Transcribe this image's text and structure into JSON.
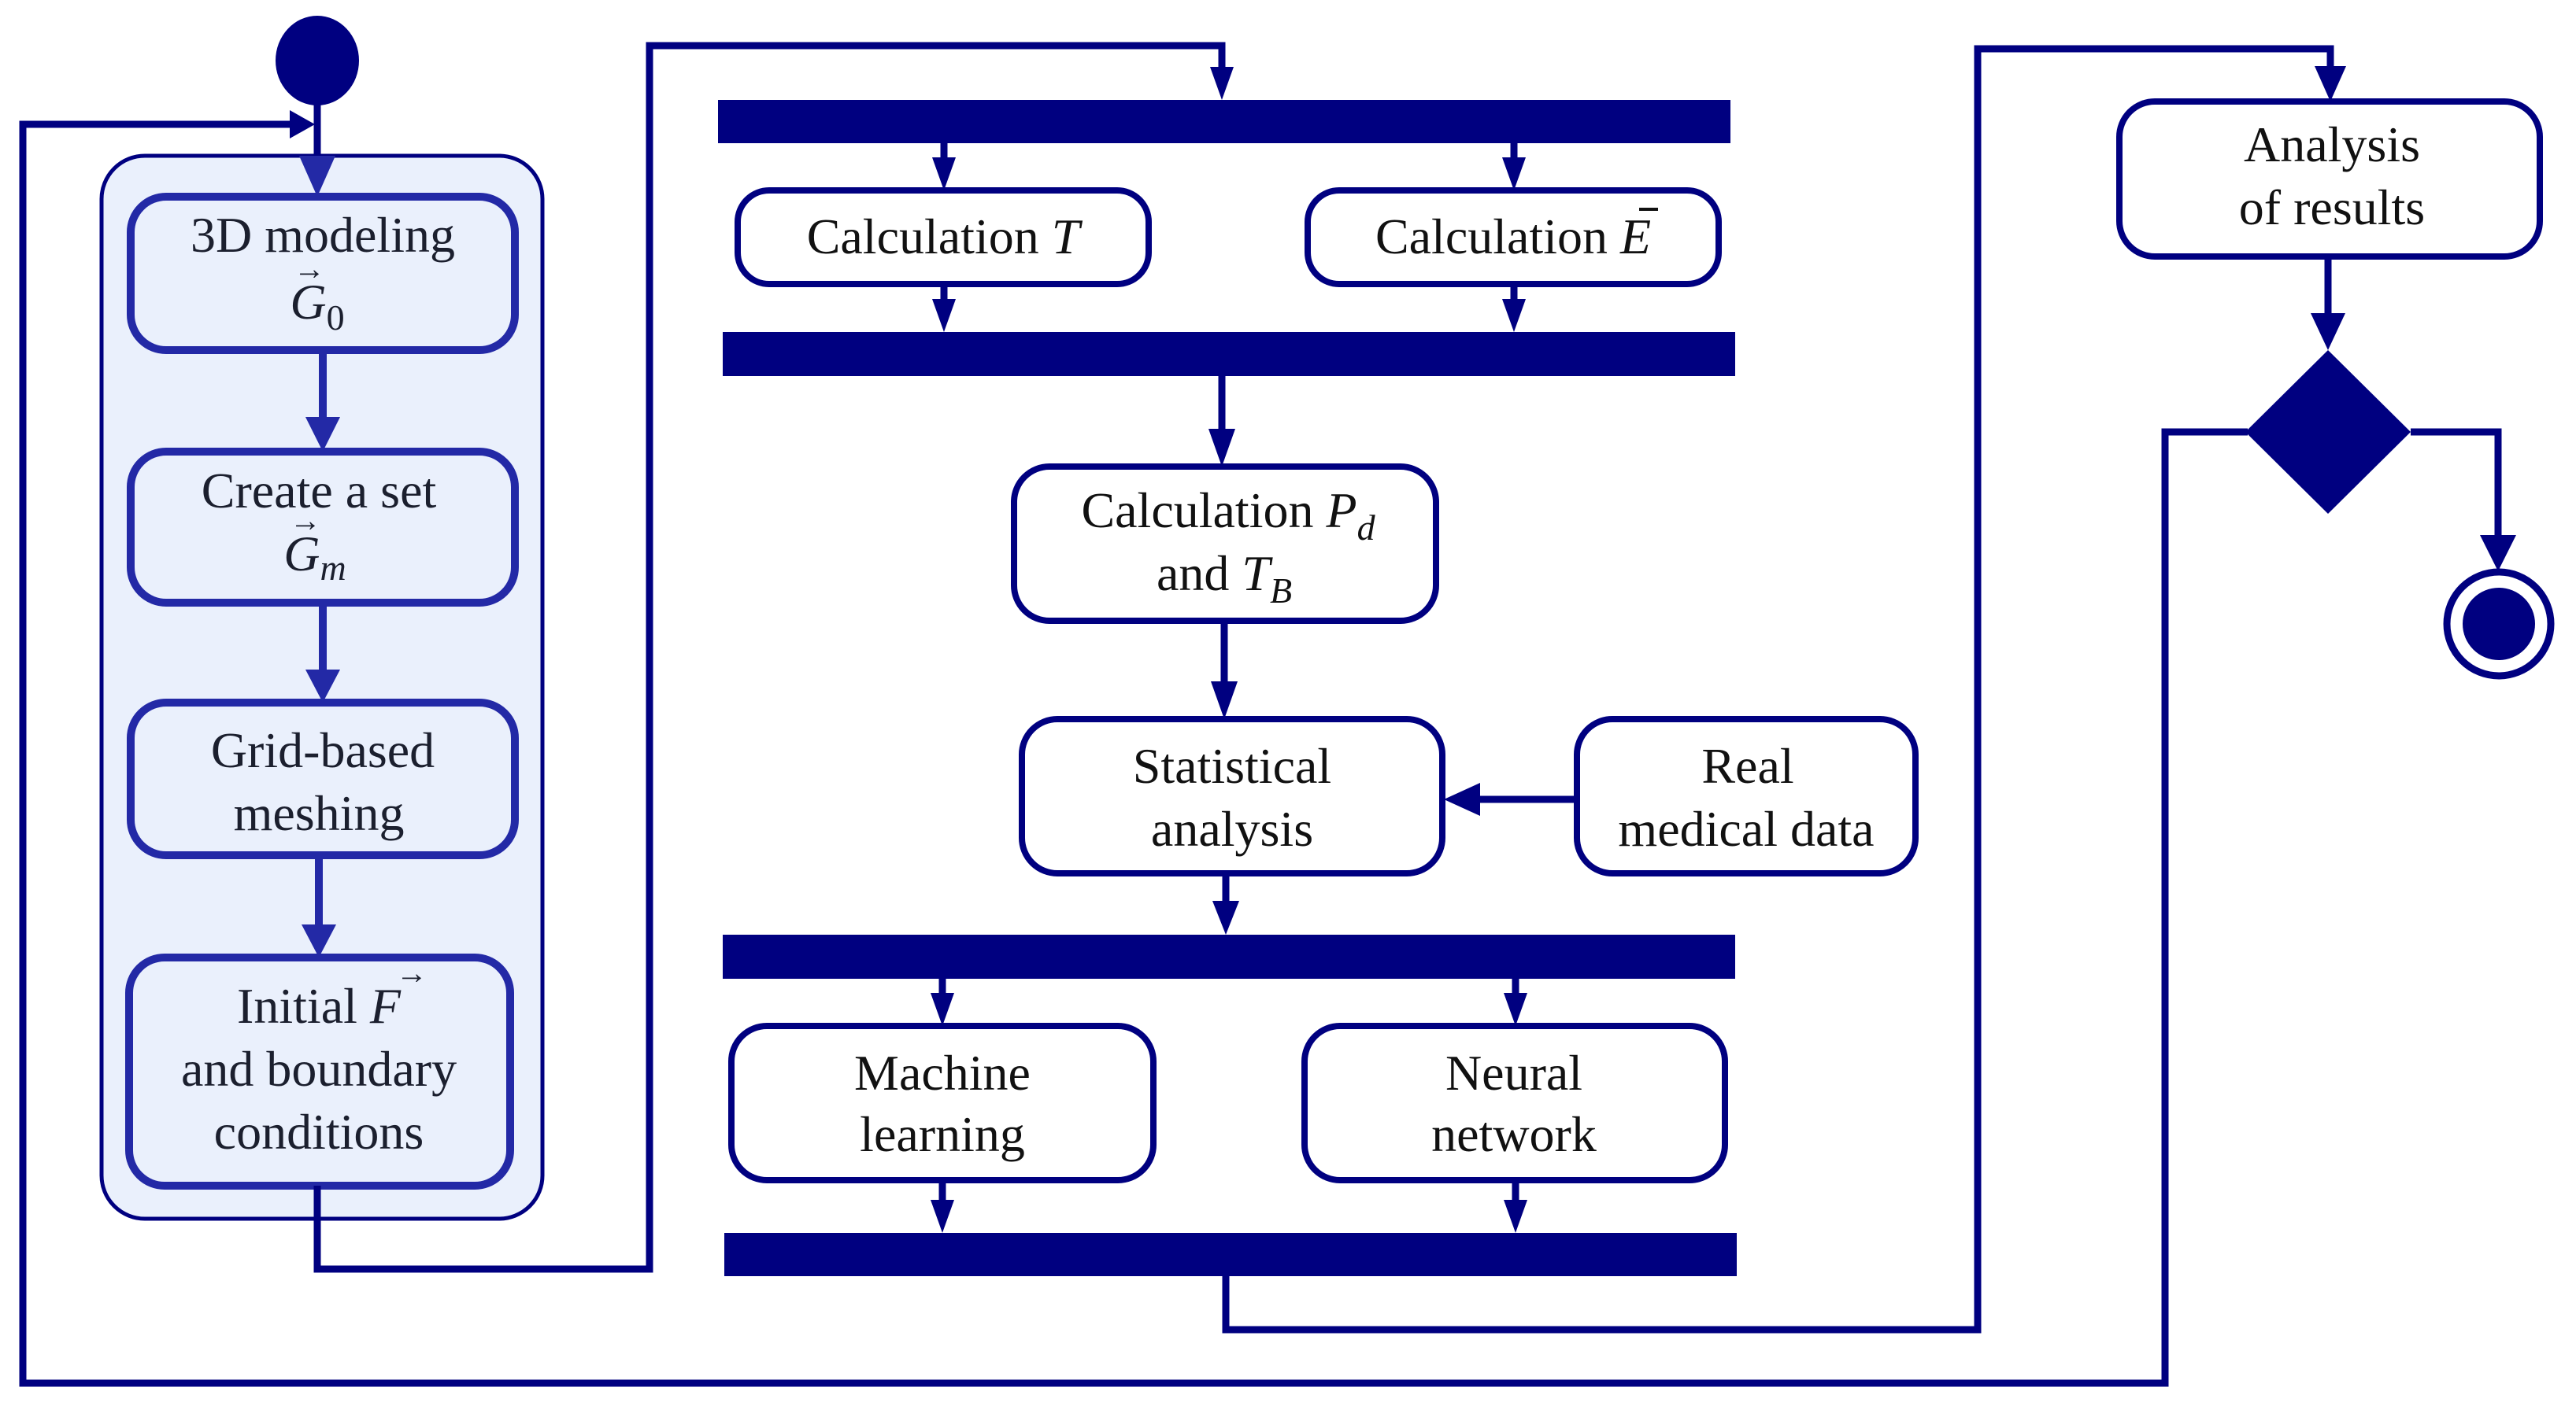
{
  "diagram": {
    "type": "UML activity diagram",
    "colors": {
      "primary": "#000080",
      "inner_stroke": "#2329a6",
      "group_fill": "#eaf0fc",
      "text": "#111111"
    },
    "start_node": {
      "label": "initial-node"
    },
    "end_node": {
      "label": "final-node"
    },
    "preprocessing_group": {
      "steps": [
        {
          "id": "modeling",
          "line1": "3D modeling",
          "symbol": "G",
          "symbol_sub": "0",
          "vector": "→"
        },
        {
          "id": "create-set",
          "line1": "Create a set",
          "symbol": "G",
          "symbol_sub": "m",
          "vector": "→"
        },
        {
          "id": "meshing",
          "line1": "Grid-based",
          "line2": "meshing"
        },
        {
          "id": "initial",
          "line1": "Initial",
          "symbol": "F",
          "vector": "→",
          "line2": "and boundary",
          "line3": "conditions"
        }
      ]
    },
    "fork1": {
      "left": {
        "text": "Calculation",
        "symbol": "T"
      },
      "right": {
        "text": "Calculation",
        "symbol": "E",
        "overbar": "‾"
      }
    },
    "calc_pd": {
      "line1": "Calculation",
      "symbol1": "P",
      "sub1": "d",
      "line2": "and",
      "symbol2": "T",
      "sub2": "B"
    },
    "statistical": {
      "line1": "Statistical",
      "line2": "analysis"
    },
    "real_data": {
      "line1": "Real",
      "line2": "medical data"
    },
    "fork2": {
      "left": {
        "line1": "Machine",
        "line2": "learning"
      },
      "right": {
        "line1": "Neural",
        "line2": "network"
      }
    },
    "analysis": {
      "line1": "Analysis",
      "line2": "of results"
    },
    "decision": {
      "label": "decision"
    }
  }
}
